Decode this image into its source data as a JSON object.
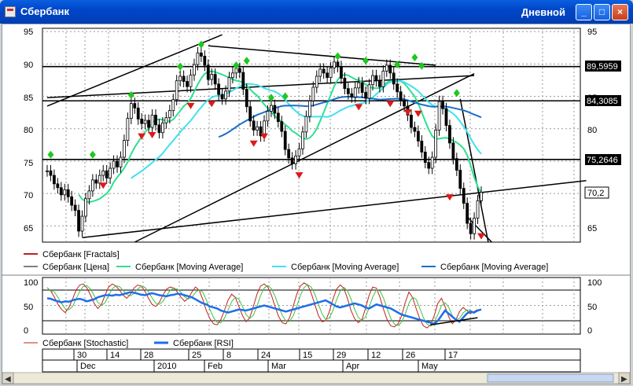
{
  "window": {
    "title": "Сбербанк",
    "timeframe": "Дневной",
    "btn_min": "_",
    "btn_max": "□",
    "btn_close": "×"
  },
  "colors": {
    "fractal_up": "#1ec81e",
    "fractal_down": "#e01818",
    "ma_fast": "#2ee090",
    "ma_mid": "#40e0f0",
    "ma_slow": "#1870c8",
    "rsi": "#1e6ee8",
    "stoch": "#c02020",
    "price": "#000000"
  },
  "chart_data": [
    {
      "type": "candlestick",
      "name": "main",
      "y_ticks": [
        "95",
        "90",
        "85",
        "80",
        "75",
        "70",
        "65"
      ],
      "ylim": [
        62.5,
        95.5
      ],
      "hlines": [
        {
          "value": 89.5959,
          "label": "89,5959"
        },
        {
          "value": 84.3085,
          "label": "84,3085"
        },
        {
          "value": 75.2646,
          "label": "75,2646"
        }
      ],
      "last_price": {
        "value": 70.2,
        "label": "70,2"
      },
      "legend": [
        {
          "label": "Сбербанк [Fractals]",
          "color": "#e01818"
        },
        {
          "label": "Сбербанк [Цена]",
          "color": "#000000"
        },
        {
          "label": "Сбербанк [Moving Average]",
          "color": "#2ee090"
        },
        {
          "label": "Сбербанк [Moving Average]",
          "color": "#40e0f0"
        },
        {
          "label": "Сбербанк [Moving Average]",
          "color": "#1870c8"
        }
      ],
      "close": [
        73.5,
        72.8,
        71.5,
        70.9,
        69.8,
        70.6,
        69.5,
        68.2,
        67.4,
        64.2,
        66.5,
        69.2,
        70.4,
        72.1,
        71.6,
        72.8,
        73.5,
        72.4,
        73.9,
        75.0,
        74.1,
        75.6,
        78.2,
        81.6,
        83.9,
        83.2,
        81.5,
        80.8,
        81.3,
        80.2,
        82.1,
        80.6,
        79.4,
        80.9,
        81.7,
        82.8,
        84.5,
        87.4,
        88.1,
        87.3,
        86.5,
        88.3,
        89.9,
        91.7,
        91.2,
        89.8,
        87.6,
        88.4,
        86.9,
        85.3,
        84.6,
        85.8,
        87.9,
        88.6,
        89.3,
        88.7,
        86.1,
        83.4,
        81.2,
        79.8,
        80.3,
        78.9,
        81.2,
        82.7,
        83.6,
        82.4,
        81.1,
        79.6,
        76.8,
        75.5,
        74.6,
        75.8,
        76.9,
        79.5,
        81.9,
        84.3,
        86.4,
        88.1,
        89.2,
        88.6,
        87.9,
        89.4,
        90.3,
        89.6,
        87.8,
        86.2,
        85.4,
        84.9,
        86.3,
        87.1,
        85.6,
        84.7,
        86.8,
        88.2,
        87.4,
        86.5,
        88.9,
        89.8,
        88.6,
        86.9,
        85.7,
        84.4,
        83.5,
        82.1,
        80.2,
        79.6,
        78.1,
        76.4,
        74.8,
        73.9,
        75.6,
        79.8,
        84.2,
        83.1,
        80.5,
        77.8,
        75.4,
        73.6,
        70.8,
        68.5,
        65.4,
        63.8,
        66.2,
        68.9,
        70.2
      ],
      "fractals_up": [
        {
          "i": 1,
          "v": 76.0
        },
        {
          "i": 13,
          "v": 76.0
        },
        {
          "i": 24,
          "v": 85.2
        },
        {
          "i": 38,
          "v": 89.6
        },
        {
          "i": 44,
          "v": 93.0
        },
        {
          "i": 54,
          "v": 89.8
        },
        {
          "i": 57,
          "v": 90.5
        },
        {
          "i": 64,
          "v": 84.8
        },
        {
          "i": 68,
          "v": 85.0
        },
        {
          "i": 83,
          "v": 91.2
        },
        {
          "i": 91,
          "v": 90.5
        },
        {
          "i": 100,
          "v": 89.9
        },
        {
          "i": 105,
          "v": 91.0
        },
        {
          "i": 107,
          "v": 89.7
        },
        {
          "i": 117,
          "v": 85.5
        }
      ],
      "fractals_down": [
        {
          "i": 16,
          "v": 71.2
        },
        {
          "i": 27,
          "v": 78.8
        },
        {
          "i": 30,
          "v": 79.0
        },
        {
          "i": 41,
          "v": 83.5
        },
        {
          "i": 47,
          "v": 83.8
        },
        {
          "i": 59,
          "v": 77.7
        },
        {
          "i": 62,
          "v": 78.8
        },
        {
          "i": 72,
          "v": 72.8
        },
        {
          "i": 89,
          "v": 83.3
        },
        {
          "i": 98,
          "v": 83.8
        },
        {
          "i": 103,
          "v": 82.5
        },
        {
          "i": 106,
          "v": 82.3
        },
        {
          "i": 115,
          "v": 69.4
        },
        {
          "i": 124,
          "v": 63.4
        }
      ]
    },
    {
      "type": "line",
      "name": "oscillator",
      "y_ticks": [
        "100",
        "50",
        "0"
      ],
      "ylim": [
        0,
        100
      ],
      "hlines": [
        20,
        50,
        80
      ],
      "legend": [
        {
          "label": "Сбербанк [Stochastic]",
          "color": "#c02020"
        },
        {
          "label": "Сбербанк [RSI]",
          "color": "#1e6ee8"
        }
      ],
      "rsi": [
        64,
        63,
        60,
        58,
        56,
        58,
        57,
        60,
        62,
        63,
        61,
        58,
        60,
        62,
        66,
        68,
        70,
        70,
        69,
        71,
        70,
        72,
        74,
        76,
        75,
        73,
        71,
        70,
        72,
        74,
        72,
        70,
        69,
        68,
        70,
        71,
        73,
        72,
        70,
        68,
        66,
        62,
        58,
        54,
        52,
        48,
        46,
        44,
        40,
        38,
        36,
        38,
        40,
        42,
        41,
        40,
        42,
        44,
        46,
        48,
        50,
        48,
        46,
        44,
        42,
        40,
        38,
        40,
        42,
        44,
        46,
        48,
        50,
        52,
        54,
        56,
        58,
        60,
        56,
        52,
        48,
        46,
        48,
        50,
        52,
        54,
        52,
        50,
        46,
        44,
        48,
        52,
        50,
        48,
        46,
        44,
        40,
        36,
        32,
        30,
        28,
        26,
        24,
        22,
        20,
        18,
        16,
        14,
        20,
        30,
        40,
        34,
        28,
        22,
        18,
        26,
        34,
        38,
        36,
        40,
        42
      ],
      "stoch": [
        85,
        78,
        66,
        52,
        42,
        36,
        46,
        62,
        80,
        90,
        92,
        84,
        70,
        54,
        44,
        52,
        70,
        86,
        92,
        88,
        80,
        70,
        64,
        72,
        84,
        90,
        88,
        78,
        64,
        52,
        48,
        56,
        70,
        82,
        86,
        84,
        76,
        66,
        58,
        64,
        76,
        86,
        80,
        62,
        40,
        24,
        14,
        12,
        22,
        40,
        60,
        72,
        66,
        48,
        30,
        18,
        26,
        48,
        72,
        88,
        92,
        86,
        70,
        48,
        28,
        16,
        14,
        26,
        48,
        72,
        88,
        94,
        90,
        74,
        52,
        30,
        18,
        20,
        38,
        62,
        82,
        90,
        84,
        64,
        40,
        24,
        16,
        22,
        44,
        70,
        86,
        84,
        66,
        42,
        22,
        10,
        8,
        14,
        30,
        56,
        76,
        66,
        44,
        24,
        10,
        6,
        12,
        30,
        54,
        64,
        48,
        28,
        14,
        22,
        38,
        46,
        40,
        34,
        38,
        42
      ]
    }
  ],
  "time_axis": {
    "days": [
      "30",
      "14",
      "28",
      "25",
      "8",
      "24",
      "15",
      "29",
      "12",
      "26",
      "17"
    ],
    "months": [
      "Dec",
      "2010",
      "Feb",
      "Mar",
      "Apr",
      "May"
    ]
  }
}
